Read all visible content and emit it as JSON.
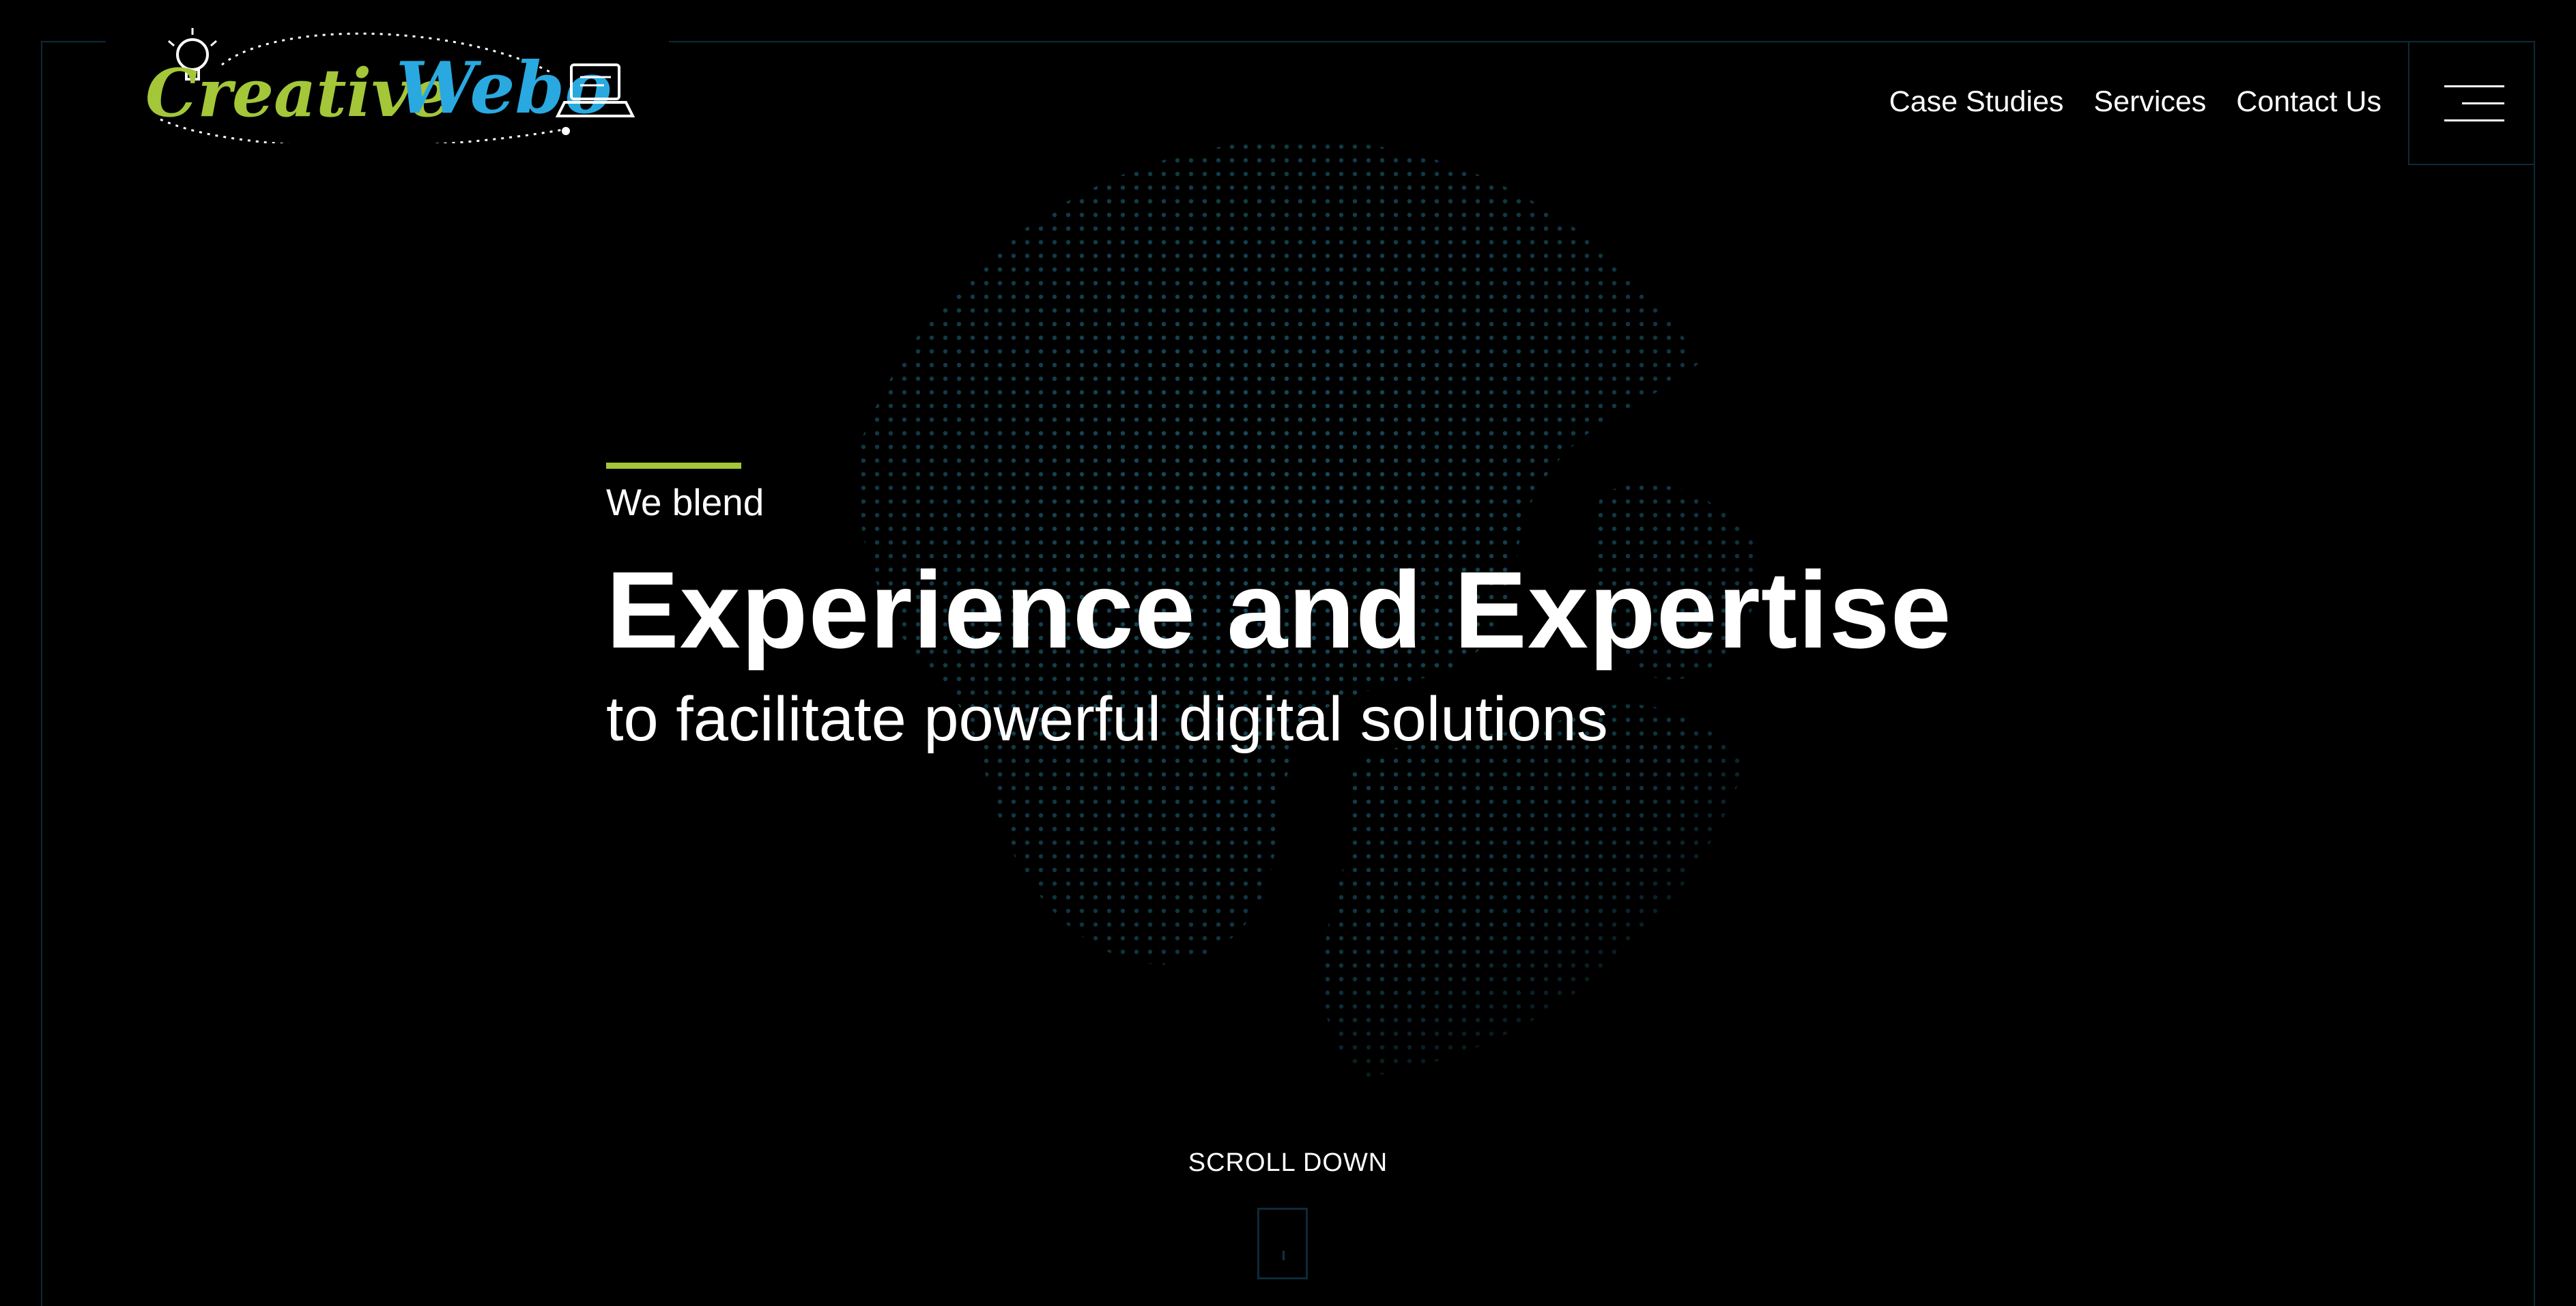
{
  "brand": {
    "logo_text_primary": "Creative",
    "logo_text_secondary": "Webo",
    "colors": {
      "green": "#a4c639",
      "blue": "#29a9e0",
      "frame": "#0d2a38",
      "globe_dots": "#1f6e86"
    }
  },
  "nav": {
    "items": [
      {
        "label": "Case Studies"
      },
      {
        "label": "Services"
      },
      {
        "label": "Contact Us"
      }
    ]
  },
  "menu_icon": "hamburger-icon",
  "hero": {
    "kicker": "We blend",
    "headline": "Experience and Expertise",
    "subline": "to facilitate powerful digital solutions"
  },
  "scroll": {
    "label": "SCROLL DOWN",
    "icon": "mouse-icon"
  }
}
